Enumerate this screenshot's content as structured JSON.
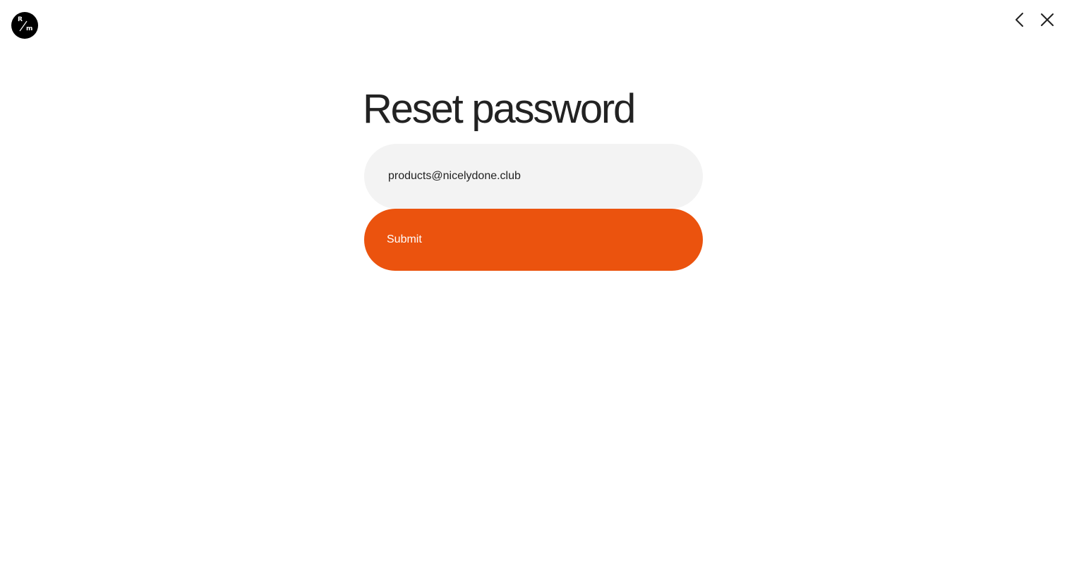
{
  "header": {
    "logo": {
      "top_letter": "R",
      "bottom_letter": "m",
      "icon": "brand-logo"
    },
    "back_icon": "chevron-left-icon",
    "close_icon": "close-icon"
  },
  "form": {
    "title": "Reset password",
    "email_value": "products@nicelydone.club",
    "submit_label": "Submit"
  },
  "colors": {
    "accent": "#eb530e",
    "input_bg": "#f3f3f3",
    "text": "#222222"
  }
}
